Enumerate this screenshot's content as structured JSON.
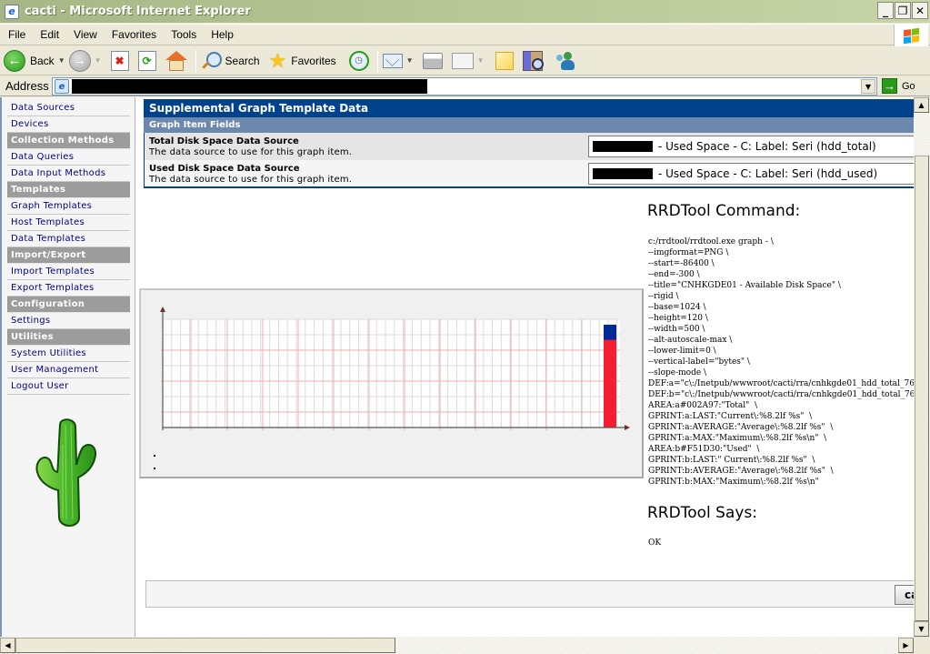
{
  "window": {
    "title": "cacti - Microsoft Internet Explorer",
    "controls": [
      "minimize",
      "restore",
      "close"
    ]
  },
  "menubar": {
    "items": [
      "File",
      "Edit",
      "View",
      "Favorites",
      "Tools",
      "Help"
    ]
  },
  "toolbar": {
    "back_label": "Back",
    "search_label": "Search",
    "favorites_label": "Favorites"
  },
  "addressbar": {
    "label": "Address",
    "url": "[redacted]",
    "go_label": "Go"
  },
  "sidebar": {
    "items": [
      {
        "type": "link",
        "label": "Data Sources"
      },
      {
        "type": "link",
        "label": "Devices"
      },
      {
        "type": "header",
        "label": "Collection Methods"
      },
      {
        "type": "link",
        "label": "Data Queries"
      },
      {
        "type": "link",
        "label": "Data Input Methods"
      },
      {
        "type": "header",
        "label": "Templates"
      },
      {
        "type": "link",
        "label": "Graph Templates"
      },
      {
        "type": "link",
        "label": "Host Templates"
      },
      {
        "type": "link",
        "label": "Data Templates"
      },
      {
        "type": "header",
        "label": "Import/Export"
      },
      {
        "type": "link",
        "label": "Import Templates"
      },
      {
        "type": "link",
        "label": "Export Templates"
      },
      {
        "type": "header",
        "label": "Configuration"
      },
      {
        "type": "link",
        "label": "Settings"
      },
      {
        "type": "header",
        "label": "Utilities"
      },
      {
        "type": "link",
        "label": "System Utilities"
      },
      {
        "type": "link",
        "label": "User Management"
      },
      {
        "type": "link",
        "label": "Logout User"
      }
    ]
  },
  "main": {
    "section_title": "Supplemental Graph Template Data",
    "sub_title": "Graph Item Fields",
    "fields": [
      {
        "title": "Total Disk Space Data Source",
        "description": "The data source to use for this graph item.",
        "selected_value": "- Used Space - C: Label: Seri (hdd_total)"
      },
      {
        "title": "Used Disk Space Data Source",
        "description": "The data source to use for this graph item.",
        "selected_value": "- Used Space - C: Label: Seri (hdd_used)"
      }
    ],
    "rrd_command_title": "RRDTool Command:",
    "rrd_command": "c:/rrdtool/rrdtool.exe graph - \\\n--imgformat=PNG \\\n--start=-86400 \\\n--end=-300 \\\n--title=\"CNHKGDE01 - Available Disk Space\" \\\n--rigid \\\n--base=1024 \\\n--height=120 \\\n--width=500 \\\n--alt-autoscale-max \\\n--lower-limit=0 \\\n--vertical-label=\"bytes\" \\\n--slope-mode \\\nDEF:a=\"c\\:/Inetpub/wwwroot/cacti/rra/cnhkgde01_hdd_total_76\nDEF:b=\"c\\:/Inetpub/wwwroot/cacti/rra/cnhkgde01_hdd_total_76\nAREA:a#002A97:\"Total\"  \\\nGPRINT:a:LAST:\"Current\\:%8.2lf %s\"  \\\nGPRINT:a:AVERAGE:\"Average\\:%8.2lf %s\"  \\\nGPRINT:a:MAX:\"Maximum\\:%8.2lf %s\\n\"  \\\nAREA:b#F51D30:\"Used\"  \\\nGPRINT:b:LAST:\" Current\\:%8.2lf %s\"  \\\nGPRINT:b:AVERAGE:\"Average\\:%8.2lf %s\"  \\\nGPRINT:b:MAX:\"Maximum\\:%8.2lf %s\\n\"",
    "rrd_says_title": "RRDTool Says:",
    "rrd_says": "OK",
    "bottom_button_label": "ca"
  },
  "graph": {
    "series_colors": {
      "total": "#002A97",
      "used": "#F51D30"
    },
    "total_fraction": 0.95,
    "used_fraction": 0.81,
    "legend_bullets": 2
  },
  "colors": {
    "section_header": "#00438C",
    "sub_header": "#6D88AD",
    "sidebar_link": "#000080",
    "sidebar_header": "#9C9C9C"
  }
}
